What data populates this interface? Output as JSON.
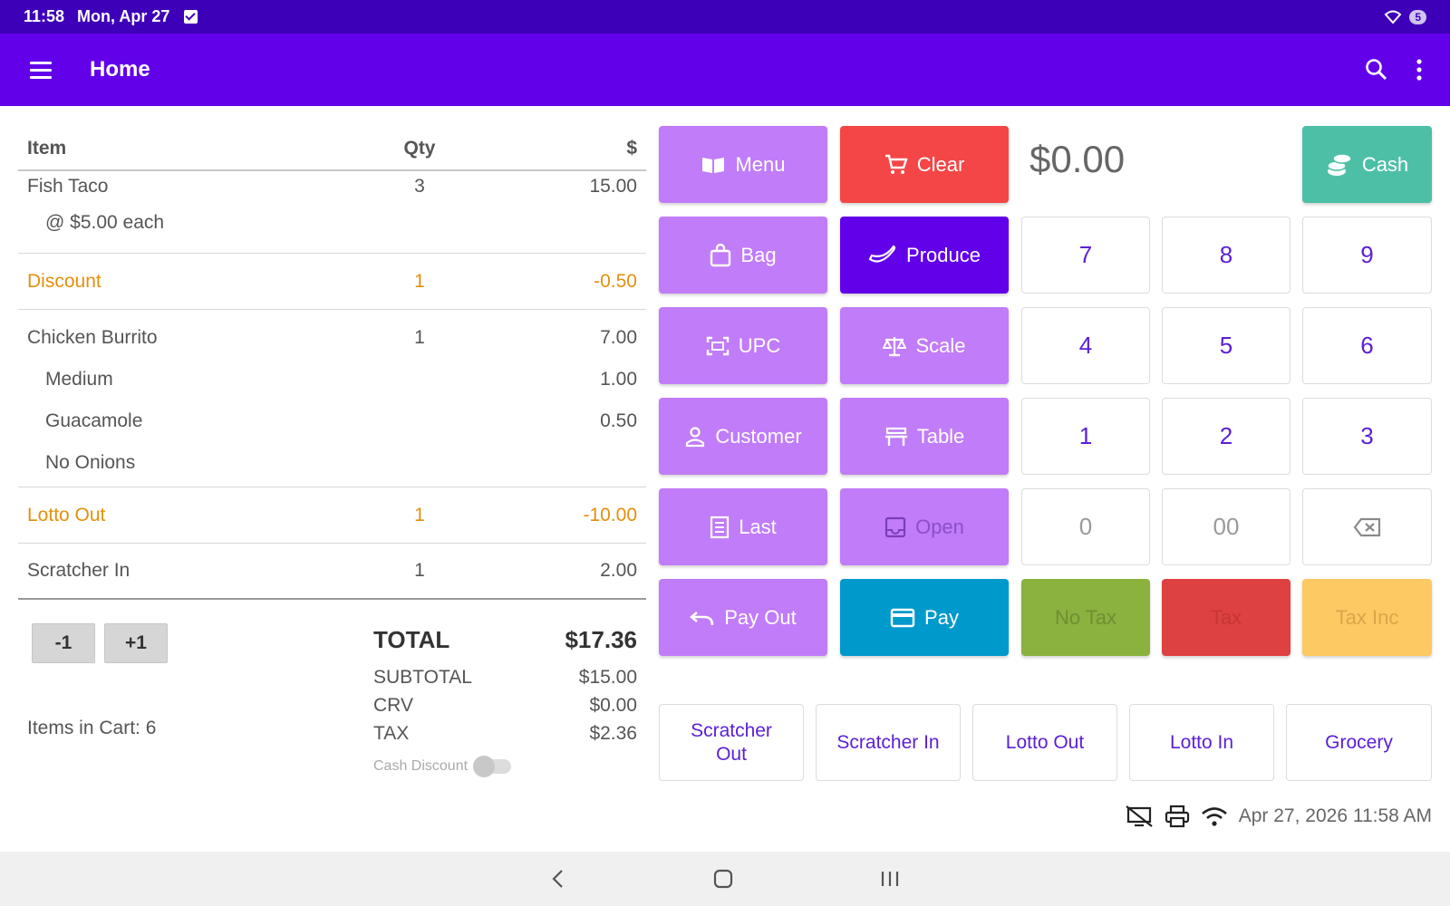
{
  "status_bar": {
    "time": "11:58",
    "date": "Mon, Apr 27",
    "battery": "5"
  },
  "app_bar": {
    "title": "Home"
  },
  "cart": {
    "headers": {
      "item": "Item",
      "qty": "Qty",
      "amount": "$"
    },
    "lines": [
      {
        "name": "Fish Taco",
        "qty": "3",
        "amount": "15.00"
      },
      {
        "name": "@ $5.00 each",
        "qty": "",
        "amount": ""
      },
      {
        "name": "Discount",
        "qty": "1",
        "amount": "-0.50"
      },
      {
        "name": "Chicken Burrito",
        "qty": "1",
        "amount": "7.00"
      },
      {
        "name": "Medium",
        "qty": "",
        "amount": "1.00"
      },
      {
        "name": "Guacamole",
        "qty": "",
        "amount": "0.50"
      },
      {
        "name": "No Onions",
        "qty": "",
        "amount": ""
      },
      {
        "name": "Lotto Out",
        "qty": "1",
        "amount": "-10.00"
      },
      {
        "name": "Scratcher In",
        "qty": "1",
        "amount": "2.00"
      }
    ],
    "minus_label": "-1",
    "plus_label": "+1",
    "items_in_cart": "Items in Cart:  6",
    "total_label": "TOTAL",
    "total_value": "$17.36",
    "subtotal_label": "SUBTOTAL",
    "subtotal_value": "$15.00",
    "crv_label": "CRV",
    "crv_value": "$0.00",
    "tax_label": "TAX",
    "tax_value": "$2.36",
    "cash_discount_label": "Cash Discount"
  },
  "buttons": {
    "menu": "Menu",
    "clear": "Clear",
    "amount": "$0.00",
    "cash": "Cash",
    "bag": "Bag",
    "produce": "Produce",
    "upc": "UPC",
    "scale": "Scale",
    "customer": "Customer",
    "table": "Table",
    "last": "Last",
    "open": "Open",
    "pay_out": "Pay Out",
    "pay": "Pay",
    "no_tax": "No Tax",
    "tax": "Tax",
    "tax_inc": "Tax Inc"
  },
  "keypad": {
    "k7": "7",
    "k8": "8",
    "k9": "9",
    "k4": "4",
    "k5": "5",
    "k6": "6",
    "k1": "1",
    "k2": "2",
    "k3": "3",
    "k0": "0",
    "k00": "00"
  },
  "quick_buttons": {
    "scratcher_out_1": "Scratcher",
    "scratcher_out_2": "Out",
    "scratcher_in": "Scratcher In",
    "lotto_out": "Lotto Out",
    "lotto_in": "Lotto In",
    "grocery": "Grocery"
  },
  "footer": {
    "datetime": "Apr 27, 2026 11:58 AM"
  },
  "colors": {
    "status_bar": "#3d00b8",
    "app_bar": "#6200ea",
    "purple_button": "#c17cf9",
    "clear_button": "#f44646",
    "cash_button": "#4ebfa7",
    "pay_button": "#0099cc",
    "discount_text": "#e3900d"
  }
}
